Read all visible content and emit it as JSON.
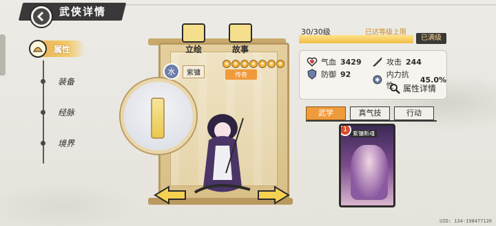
{
  "header": {
    "title": "武侠详情"
  },
  "nav": {
    "active": {
      "label": "属性"
    },
    "items": [
      {
        "label": "装备"
      },
      {
        "label": "经脉"
      },
      {
        "label": "境界"
      }
    ]
  },
  "portrait": {
    "buttons": {
      "standing_label": "立绘",
      "story_label": "故事"
    },
    "character_name": "紫镛",
    "element_badge": "水",
    "stars": 7,
    "rarity": "传奇"
  },
  "level": {
    "text": "30/30级",
    "note": "已达等级上限",
    "progress": 1.0,
    "max_label": "已满级"
  },
  "stats": {
    "hp": {
      "label": "气血",
      "value": "3429"
    },
    "attack": {
      "label": "攻击",
      "value": "244"
    },
    "defense": {
      "label": "防御",
      "value": "92"
    },
    "resist": {
      "label": "内力抗性",
      "value": "45.0%"
    },
    "detail_label": "属性详情"
  },
  "tabs": [
    {
      "label": "武学"
    },
    {
      "label": "真气技"
    },
    {
      "label": "行动"
    }
  ],
  "skill_card": {
    "title": "紫镛断魂",
    "badge": "1"
  },
  "footer": {
    "uid": "UID: 134-198477120"
  },
  "colors": {
    "accent": "#ef9b3c",
    "gold": "#f2bd45",
    "dark": "#3a3838"
  }
}
